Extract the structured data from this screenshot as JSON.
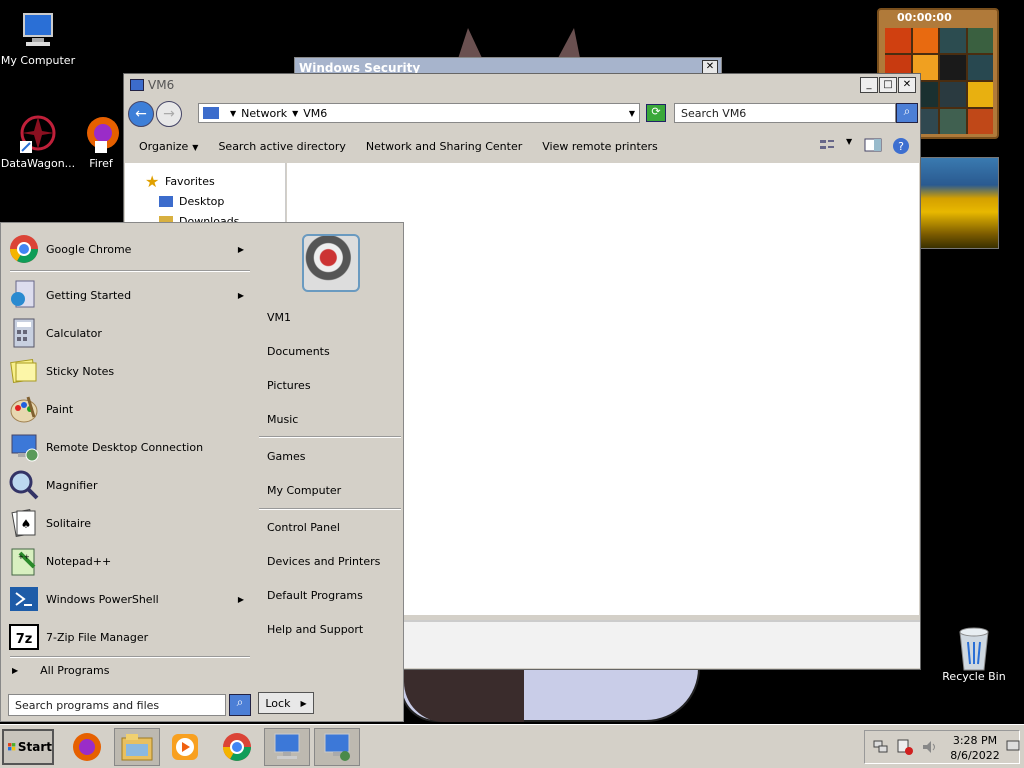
{
  "desktop": {
    "icons": [
      {
        "label": "My Computer",
        "icon": "computer-icon"
      },
      {
        "label": "DataWagon...",
        "icon": "datawagon-icon"
      },
      {
        "label": "Firef",
        "icon": "firefox-icon"
      },
      {
        "label": "Recycle Bin",
        "icon": "recycle-bin-icon"
      }
    ],
    "puzzle": {
      "time": "00:00:00"
    }
  },
  "security_window": {
    "title": "Windows Security"
  },
  "explorer": {
    "title": "VM6",
    "breadcrumb": [
      "Network",
      "VM6"
    ],
    "search_placeholder": "Search VM6",
    "toolbar": [
      "Organize",
      "Search active directory",
      "Network and Sharing Center",
      "View remote printers"
    ],
    "nav": {
      "favorites": "Favorites",
      "items": [
        "Desktop",
        "Downloads"
      ]
    }
  },
  "start_menu": {
    "programs": [
      {
        "label": "Google Chrome",
        "icon": "chrome-icon",
        "submenu": true
      },
      {
        "label": "Getting Started",
        "icon": "getting-started-icon",
        "submenu": true
      },
      {
        "label": "Calculator",
        "icon": "calculator-icon",
        "submenu": false
      },
      {
        "label": "Sticky Notes",
        "icon": "sticky-notes-icon",
        "submenu": false
      },
      {
        "label": "Paint",
        "icon": "paint-icon",
        "submenu": false
      },
      {
        "label": "Remote Desktop Connection",
        "icon": "remote-desktop-icon",
        "submenu": false
      },
      {
        "label": "Magnifier",
        "icon": "magnifier-icon",
        "submenu": false
      },
      {
        "label": "Solitaire",
        "icon": "solitaire-icon",
        "submenu": false
      },
      {
        "label": "Notepad++",
        "icon": "notepadpp-icon",
        "submenu": false
      },
      {
        "label": "Windows PowerShell",
        "icon": "powershell-icon",
        "submenu": true
      },
      {
        "label": "7-Zip File Manager",
        "icon": "7zip-icon",
        "submenu": false
      }
    ],
    "all_programs": "All Programs",
    "search_placeholder": "Search programs and files",
    "right": {
      "group1": [
        "VM1",
        "Documents",
        "Pictures",
        "Music"
      ],
      "group2": [
        "Games",
        "My Computer"
      ],
      "group3": [
        "Control Panel",
        "Devices and Printers",
        "Default Programs",
        "Help and Support"
      ]
    },
    "lock_label": "Lock"
  },
  "taskbar": {
    "start_label": "Start",
    "items": [
      "firefox-icon",
      "explorer-icon",
      "media-player-icon",
      "chrome-icon",
      "remote-desktop-icon",
      "network-icon"
    ],
    "clock_time": "3:28 PM",
    "clock_date": "8/6/2022"
  }
}
